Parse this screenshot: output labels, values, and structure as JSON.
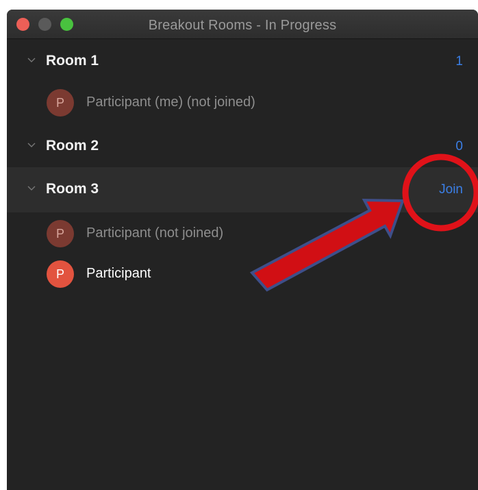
{
  "window": {
    "title": "Breakout Rooms - In Progress"
  },
  "rooms": [
    {
      "name": "Room 1",
      "count": "1",
      "participants": [
        {
          "initial": "P",
          "name": "Participant (me) (not joined)"
        }
      ]
    },
    {
      "name": "Room 2",
      "count": "0",
      "participants": []
    },
    {
      "name": "Room 3",
      "action": "Join",
      "participants": [
        {
          "initial": "P",
          "name": "Participant (not joined)"
        },
        {
          "initial": "P",
          "name": "Participant"
        }
      ]
    }
  ],
  "icons": {
    "expand": "chevron-down-icon"
  },
  "colors": {
    "background": "#232323",
    "link": "#3b7fe6",
    "avatar": "#e2533f",
    "annotation": "#d10f14"
  }
}
